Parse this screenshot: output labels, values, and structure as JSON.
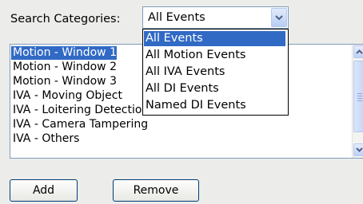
{
  "search": {
    "label": "Search Categories:",
    "selected": "All Events",
    "options": [
      "All Events",
      "All Motion Events",
      "All IVA Events",
      "All DI Events",
      "Named DI Events"
    ]
  },
  "events": {
    "items": [
      "Motion - Window 1",
      "Motion - Window 2",
      "Motion - Window 3",
      "IVA - Moving Object",
      "IVA - Loitering Detection",
      "IVA - Camera Tampering",
      "IVA - Others"
    ]
  },
  "buttons": {
    "add": "Add",
    "remove": "Remove"
  },
  "icons": {
    "dropdown": "chevron-down-icon",
    "scroll_up": "triangle-up-icon",
    "scroll_down": "triangle-down-icon"
  },
  "colors": {
    "selection": "#316ac5",
    "border": "#7f9db9",
    "background": "#ececea"
  }
}
